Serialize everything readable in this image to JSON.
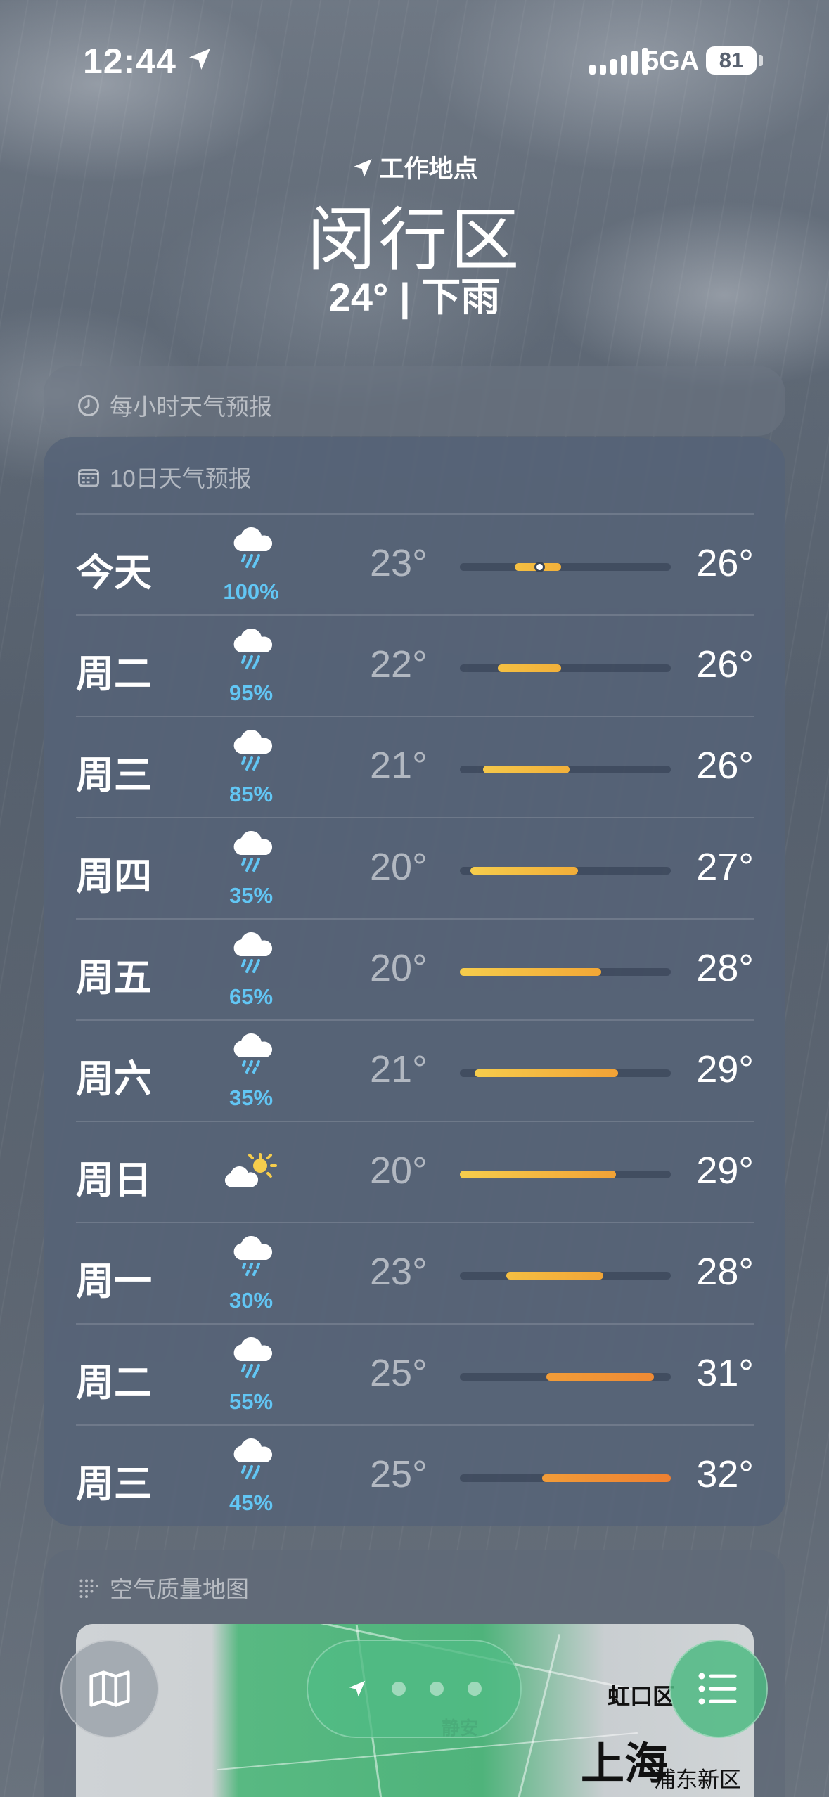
{
  "status_bar": {
    "time": "12:44",
    "network": "5GA",
    "battery": "81"
  },
  "header": {
    "location_label": "工作地点",
    "city": "闵行区",
    "summary": "24° | 下雨"
  },
  "hourly_card": {
    "title": "每小时天气预报"
  },
  "daily_card": {
    "title": "10日天气预报",
    "days": [
      {
        "day": "今天",
        "icon": "cloud-rain-icon",
        "precip": "100%",
        "low": "23°",
        "high": "26°",
        "bar_start": 0.26,
        "bar_end": 0.48,
        "bar_color_from": "#f5c042",
        "bar_color_to": "#f2b03a",
        "current_marker": 0.375
      },
      {
        "day": "周二",
        "icon": "cloud-rain-icon",
        "precip": "95%",
        "low": "22°",
        "high": "26°",
        "bar_start": 0.18,
        "bar_end": 0.48,
        "bar_color_from": "#f5c042",
        "bar_color_to": "#f2b03a"
      },
      {
        "day": "周三",
        "icon": "cloud-rain-icon",
        "precip": "85%",
        "low": "21°",
        "high": "26°",
        "bar_start": 0.11,
        "bar_end": 0.52,
        "bar_color_from": "#f5c84a",
        "bar_color_to": "#f2b03a"
      },
      {
        "day": "周四",
        "icon": "cloud-rain-icon",
        "precip": "35%",
        "low": "20°",
        "high": "27°",
        "bar_start": 0.05,
        "bar_end": 0.56,
        "bar_color_from": "#f6cd4c",
        "bar_color_to": "#f2ad38"
      },
      {
        "day": "周五",
        "icon": "cloud-rain-icon",
        "precip": "65%",
        "low": "20°",
        "high": "28°",
        "bar_start": 0.0,
        "bar_end": 0.67,
        "bar_color_from": "#f6cd4c",
        "bar_color_to": "#f2a736"
      },
      {
        "day": "周六",
        "icon": "cloud-drizzle-icon",
        "precip": "35%",
        "low": "21°",
        "high": "29°",
        "bar_start": 0.07,
        "bar_end": 0.75,
        "bar_color_from": "#f6cd4c",
        "bar_color_to": "#f2a236"
      },
      {
        "day": "周日",
        "icon": "partly-sunny-icon",
        "precip": "",
        "low": "20°",
        "high": "29°",
        "bar_start": 0.0,
        "bar_end": 0.74,
        "bar_color_from": "#f6cd4c",
        "bar_color_to": "#f2a236"
      },
      {
        "day": "周一",
        "icon": "cloud-drizzle-icon",
        "precip": "30%",
        "low": "23°",
        "high": "28°",
        "bar_start": 0.22,
        "bar_end": 0.68,
        "bar_color_from": "#f5bf42",
        "bar_color_to": "#f2a537"
      },
      {
        "day": "周二",
        "icon": "cloud-rain-icon",
        "precip": "55%",
        "low": "25°",
        "high": "31°",
        "bar_start": 0.41,
        "bar_end": 0.92,
        "bar_color_from": "#f29d38",
        "bar_color_to": "#ef8a34"
      },
      {
        "day": "周三",
        "icon": "cloud-rain-icon",
        "precip": "45%",
        "low": "25°",
        "high": "32°",
        "bar_start": 0.39,
        "bar_end": 1.0,
        "bar_color_from": "#f29c38",
        "bar_color_to": "#ee8032"
      }
    ]
  },
  "aqi_card": {
    "title": "空气质量地图",
    "map_labels": {
      "district_1": "虹口区",
      "city": "上海",
      "district_2": "浦东新区",
      "faded": "静安"
    }
  },
  "colors": {
    "precip": "#62c6f4",
    "accent_green": "#4fb37b"
  }
}
